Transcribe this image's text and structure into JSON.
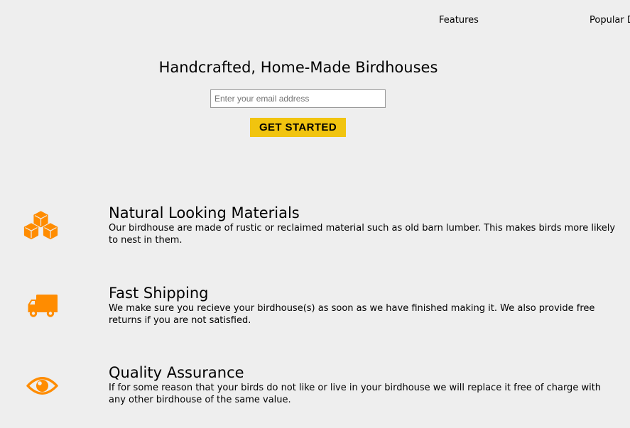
{
  "nav": {
    "features_label": "Features",
    "popular_label": "Popular D"
  },
  "hero": {
    "title": "Handcrafted, Home-Made Birdhouses",
    "email_placeholder": "Enter your email address",
    "button_label": "GET STARTED"
  },
  "features": [
    {
      "icon": "cubes-icon",
      "title": "Natural Looking Materials",
      "description": "Our birdhouse are made of rustic or reclaimed material such as old barn lumber. This makes birds more likely to nest in them."
    },
    {
      "icon": "truck-icon",
      "title": "Fast Shipping",
      "description": "We make sure you recieve your birdhouse(s) as soon as we have finished making it. We also provide free returns if you are not satisfied."
    },
    {
      "icon": "eye-icon",
      "title": "Quality Assurance",
      "description": "If for some reason that your birds do not like or live in your birdhouse we will replace it free of charge with any other birdhouse of the same value."
    }
  ],
  "colors": {
    "background": "#eeeeee",
    "accent": "#f1c40f",
    "icon": "#ff8c00"
  }
}
